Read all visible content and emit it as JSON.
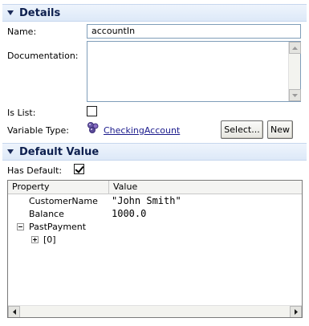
{
  "details": {
    "title": "Details",
    "name_label": "Name:",
    "name_value": "accountIn",
    "documentation_label": "Documentation:",
    "documentation_value": "",
    "is_list_label": "Is List:",
    "is_list_checked": false,
    "variable_type_label": "Variable Type:",
    "variable_type_link": "CheckingAccount",
    "select_button": "Select...",
    "new_button": "New"
  },
  "default_value": {
    "title": "Default Value",
    "has_default_label": "Has Default:",
    "has_default_checked": true,
    "table": {
      "columns": [
        "Property",
        "Value"
      ],
      "rows": [
        {
          "property": "CustomerName",
          "value": "\"John Smith\""
        },
        {
          "property": "Balance",
          "value": "1000.0"
        },
        {
          "property": "PastPayment",
          "value": ""
        },
        {
          "property": "[0]",
          "value": ""
        }
      ]
    }
  },
  "icons": {
    "details_toggle": "collapse-triangle-icon",
    "default_value_toggle": "collapse-triangle-icon",
    "variable_type": "business-object-icon",
    "past_payment_toggle": "tree-collapse-icon",
    "item_toggle": "tree-expand-icon"
  }
}
